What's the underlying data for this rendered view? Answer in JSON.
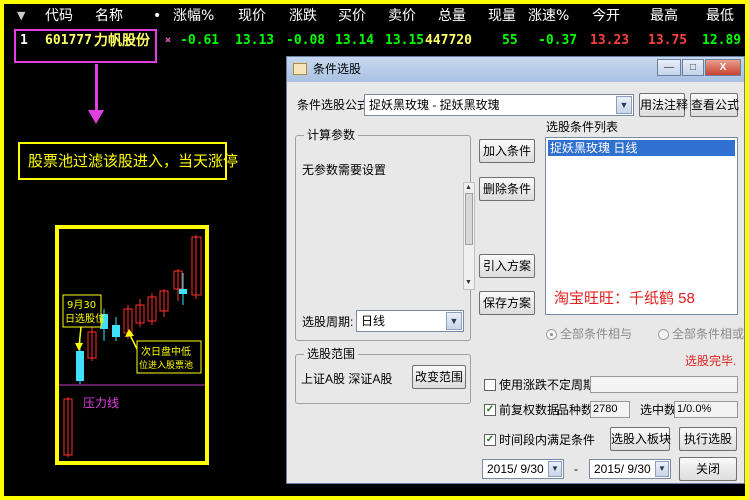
{
  "colors": {
    "frame": "#ffff00",
    "highlight": "#e040e0",
    "up": "#ff4040",
    "down": "#00ff00",
    "select": "#3070d0"
  },
  "quote_table": {
    "toggle": "▼",
    "headers": [
      "代码",
      "名称",
      "•",
      "涨幅%",
      "现价",
      "涨跌",
      "买价",
      "卖价",
      "总量",
      "现量",
      "涨速%",
      "今开",
      "最高",
      "最低"
    ],
    "row": {
      "index": "1",
      "code": "601777",
      "name": "力帆股份",
      "mark": "×",
      "change_pct": "-0.61",
      "price": "13.13",
      "change": "-0.08",
      "bid": "13.14",
      "ask": "13.15",
      "volume": "447720",
      "last_volume": "55",
      "speed": "-0.37",
      "open": "13.23",
      "high": "13.75",
      "low": "12.89"
    }
  },
  "callout": "股票池过滤该股进入，当天涨停",
  "mini_chart": {
    "date_label_1": "9月30",
    "date_label_2": "日选股位",
    "entry_label_1": "次日盘中低",
    "entry_label_2": "位进入股票池",
    "pressure_label": "压力线"
  },
  "dialog": {
    "title": "条件选股",
    "window_buttons": {
      "minimize": "—",
      "maximize": "□",
      "close": "X"
    },
    "formula_label": "条件选股公式",
    "formula_value": "捉妖黑玫瑰  - 捉妖黑玫瑰",
    "usage_button": "用法注释",
    "view_formula_button": "查看公式",
    "params_group": "计算参数",
    "params_text": "无参数需要设置",
    "period_label": "选股周期:",
    "period_value": "日线",
    "add_condition": "加入条件",
    "delete_condition": "删除条件",
    "import_plan": "引入方案",
    "save_plan": "保存方案",
    "conditions_list_label": "选股条件列表",
    "conditions": [
      "捉妖黑玫瑰  日线"
    ],
    "watermark": "淘宝旺旺：千纸鹤 58",
    "radio_all_and": "全部条件相与",
    "radio_all_or": "全部条件相或",
    "status": "选股完毕.",
    "range_group": "选股范围",
    "range_value": "上证A股 深证A股",
    "change_range": "改变范围",
    "use_uncertain_period": "使用涨跌不定周期",
    "pre_adjust": "前复权数据",
    "stock_count_label": "品种数",
    "stock_count": "2780",
    "selected_label": "选中数",
    "selected_value": "1/0.0%",
    "period_satisfy": "时间段内满足条件",
    "select_to_block": "选股入板块",
    "run_select": "执行选股",
    "date_from": "2015/ 9/30",
    "date_sep": "-",
    "date_to": "2015/ 9/30",
    "close_button": "关闭"
  }
}
